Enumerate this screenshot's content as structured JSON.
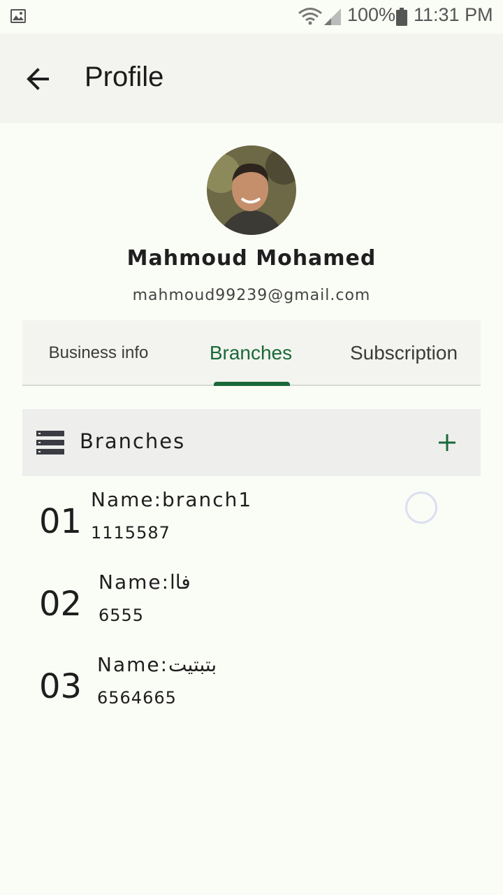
{
  "status_bar": {
    "battery": "100%",
    "time": "11:31 PM",
    "icons": [
      "gallery-icon",
      "wifi-icon",
      "signal-icon",
      "battery-icon"
    ]
  },
  "app_bar": {
    "title": "Profile",
    "back_icon": "arrow-left-icon"
  },
  "profile": {
    "name": "Mahmoud Mohamed",
    "email": "mahmoud99239@gmail.com"
  },
  "tabs": [
    {
      "label": "Business info",
      "active": false
    },
    {
      "label": "Branches",
      "active": true
    },
    {
      "label": "Subscription",
      "active": false
    }
  ],
  "branches_section": {
    "title": "Branches",
    "icon": "list-icon",
    "add_icon": "plus-icon"
  },
  "branches": [
    {
      "number": "01",
      "name": "Name:branch1",
      "phone": "1115587"
    },
    {
      "number": "02",
      "name": "Name:فاا",
      "phone": "6555"
    },
    {
      "number": "03",
      "name": "Name:بتبتيت",
      "phone": "6564665"
    }
  ],
  "colors": {
    "accent": "#1a6a39",
    "background": "#fafcf6",
    "app_bar": "#f3f4ef"
  }
}
